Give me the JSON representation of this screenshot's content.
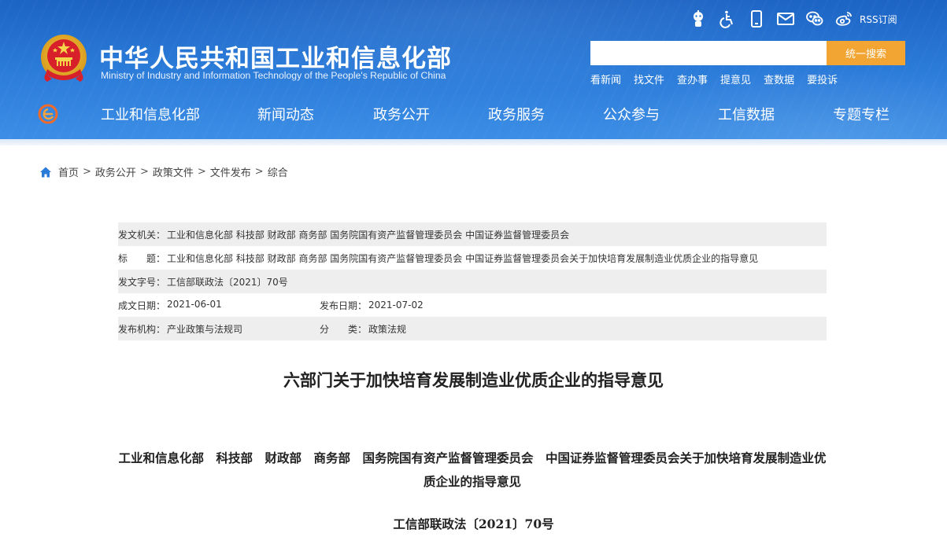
{
  "header": {
    "title": "中华人民共和国工业和信息化部",
    "subtitle": "Ministry of Industry and Information Technology of the People's Republic of China",
    "rss_label": "RSS订阅",
    "top_icons": [
      "robot-assistant-icon",
      "accessibility-icon",
      "mobile-icon",
      "mail-icon",
      "wechat-icon",
      "weibo-icon"
    ],
    "search": {
      "placeholder": "",
      "button_label": "统一搜索"
    },
    "quick_links": [
      "看新闻",
      "找文件",
      "查办事",
      "提意见",
      "查数据",
      "要投诉"
    ],
    "nav": [
      "工业和信息化部",
      "新闻动态",
      "政务公开",
      "政务服务",
      "公众参与",
      "工信数据",
      "专题专栏"
    ],
    "colors": {
      "brand_blue": "#2a7ad8",
      "search_button": "#f2a533"
    }
  },
  "breadcrumb": [
    "首页",
    "政务公开",
    "政策文件",
    "文件发布",
    "综合"
  ],
  "meta": {
    "issuer_label": "发文机关：",
    "issuer": "工业和信息化部 科技部 财政部 商务部 国务院国有资产监督管理委员会 中国证券监督管理委员会",
    "title_label": "标　　题：",
    "title": "工业和信息化部 科技部 财政部 商务部 国务院国有资产监督管理委员会 中国证券监督管理委员会关于加快培育发展制造业优质企业的指导意见",
    "doc_no_label": "发文字号：",
    "doc_no": "工信部联政法〔2021〕70号",
    "created_label": "成文日期：",
    "created": "2021-06-01",
    "published_label": "发布日期：",
    "published": "2021-07-02",
    "org_label": "发布机构：",
    "org": "产业政策与法规司",
    "category_label": "分　　类：",
    "category": "政策法规"
  },
  "article": {
    "title": "六部门关于加快培育发展制造业优质企业的指导意见",
    "heading": "工业和信息化部　科技部　财政部　商务部　国务院国有资产监督管理委员会　中国证券监督管理委员会关于加快培育发展制造业优质企业的指导意见",
    "doc_number": "工信部联政法〔2021〕70号"
  }
}
